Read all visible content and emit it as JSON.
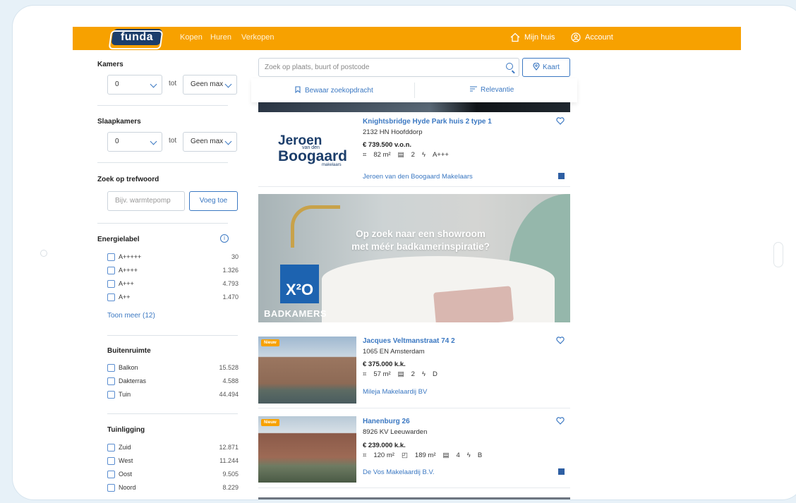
{
  "colors": {
    "brand": "#f7a100",
    "link": "#3b78c2",
    "logo_bg": "#1c3e6b"
  },
  "topbar": {
    "logo": "funda",
    "nav": [
      "Kopen",
      "Huren",
      "Verkopen"
    ],
    "mijn_huis": "Mijn huis",
    "account": "Account"
  },
  "filters": {
    "kamers": {
      "title": "Kamers",
      "min": "0",
      "tot": "tot",
      "max": "Geen max"
    },
    "slaapkamers": {
      "title": "Slaapkamers",
      "min": "0",
      "tot": "tot",
      "max": "Geen max"
    },
    "trefwoord": {
      "title": "Zoek op trefwoord",
      "placeholder": "Bijv. warmtepomp",
      "button": "Voeg toe"
    },
    "energielabel": {
      "title": "Energielabel",
      "items": [
        {
          "label": "A+++++",
          "count": "30"
        },
        {
          "label": "A++++",
          "count": "1.326"
        },
        {
          "label": "A+++",
          "count": "4.793"
        },
        {
          "label": "A++",
          "count": "1.470"
        }
      ],
      "more": "Toon meer (12)"
    },
    "buitenruimte": {
      "title": "Buitenruimte",
      "items": [
        {
          "label": "Balkon",
          "count": "15.528"
        },
        {
          "label": "Dakterras",
          "count": "4.588"
        },
        {
          "label": "Tuin",
          "count": "44.494"
        }
      ]
    },
    "tuinligging": {
      "title": "Tuinligging",
      "items": [
        {
          "label": "Zuid",
          "count": "12.871"
        },
        {
          "label": "West",
          "count": "11.244"
        },
        {
          "label": "Oost",
          "count": "9.505"
        },
        {
          "label": "Noord",
          "count": "8.229"
        }
      ]
    }
  },
  "search": {
    "placeholder": "Zoek op plaats, buurt of postcode",
    "kaart": "Kaart"
  },
  "sortbar": {
    "save": "Bewaar zoekopdracht",
    "sort": "Relevantie"
  },
  "listings": [
    {
      "title": "Knightsbridge Hyde Park huis 2 type 1",
      "addr": "2132 HN Hoofddorp",
      "price": "€ 739.500 v.o.n.",
      "area": "82 m²",
      "rooms": "2",
      "label": "A+++",
      "agent": "Jeroen van den Boogaard Makelaars",
      "logo_line1": "Jeroen",
      "logo_line2": "Boogaard",
      "logo_small": "van den",
      "logo_sub": "makelaars"
    },
    {
      "title": "Jacques Veltmanstraat 74 2",
      "addr": "1065 EN Amsterdam",
      "price": "€ 375.000 k.k.",
      "area": "57 m²",
      "rooms": "2",
      "label": "D",
      "agent": "Mileja Makelaardij BV",
      "badge": "Nieuw"
    },
    {
      "title": "Hanenburg 26",
      "addr": "8926 KV Leeuwarden",
      "price": "€ 239.000 k.k.",
      "area": "120 m²",
      "plot": "189 m²",
      "rooms": "4",
      "label": "B",
      "agent": "De Vos Makelaardij B.V.",
      "badge": "Nieuw"
    }
  ],
  "banner": {
    "line1": "Op zoek naar een showroom",
    "line2": "met méér badkamerinspiratie?",
    "brand": "X²O",
    "brand_sub": "BADKAMERS"
  }
}
